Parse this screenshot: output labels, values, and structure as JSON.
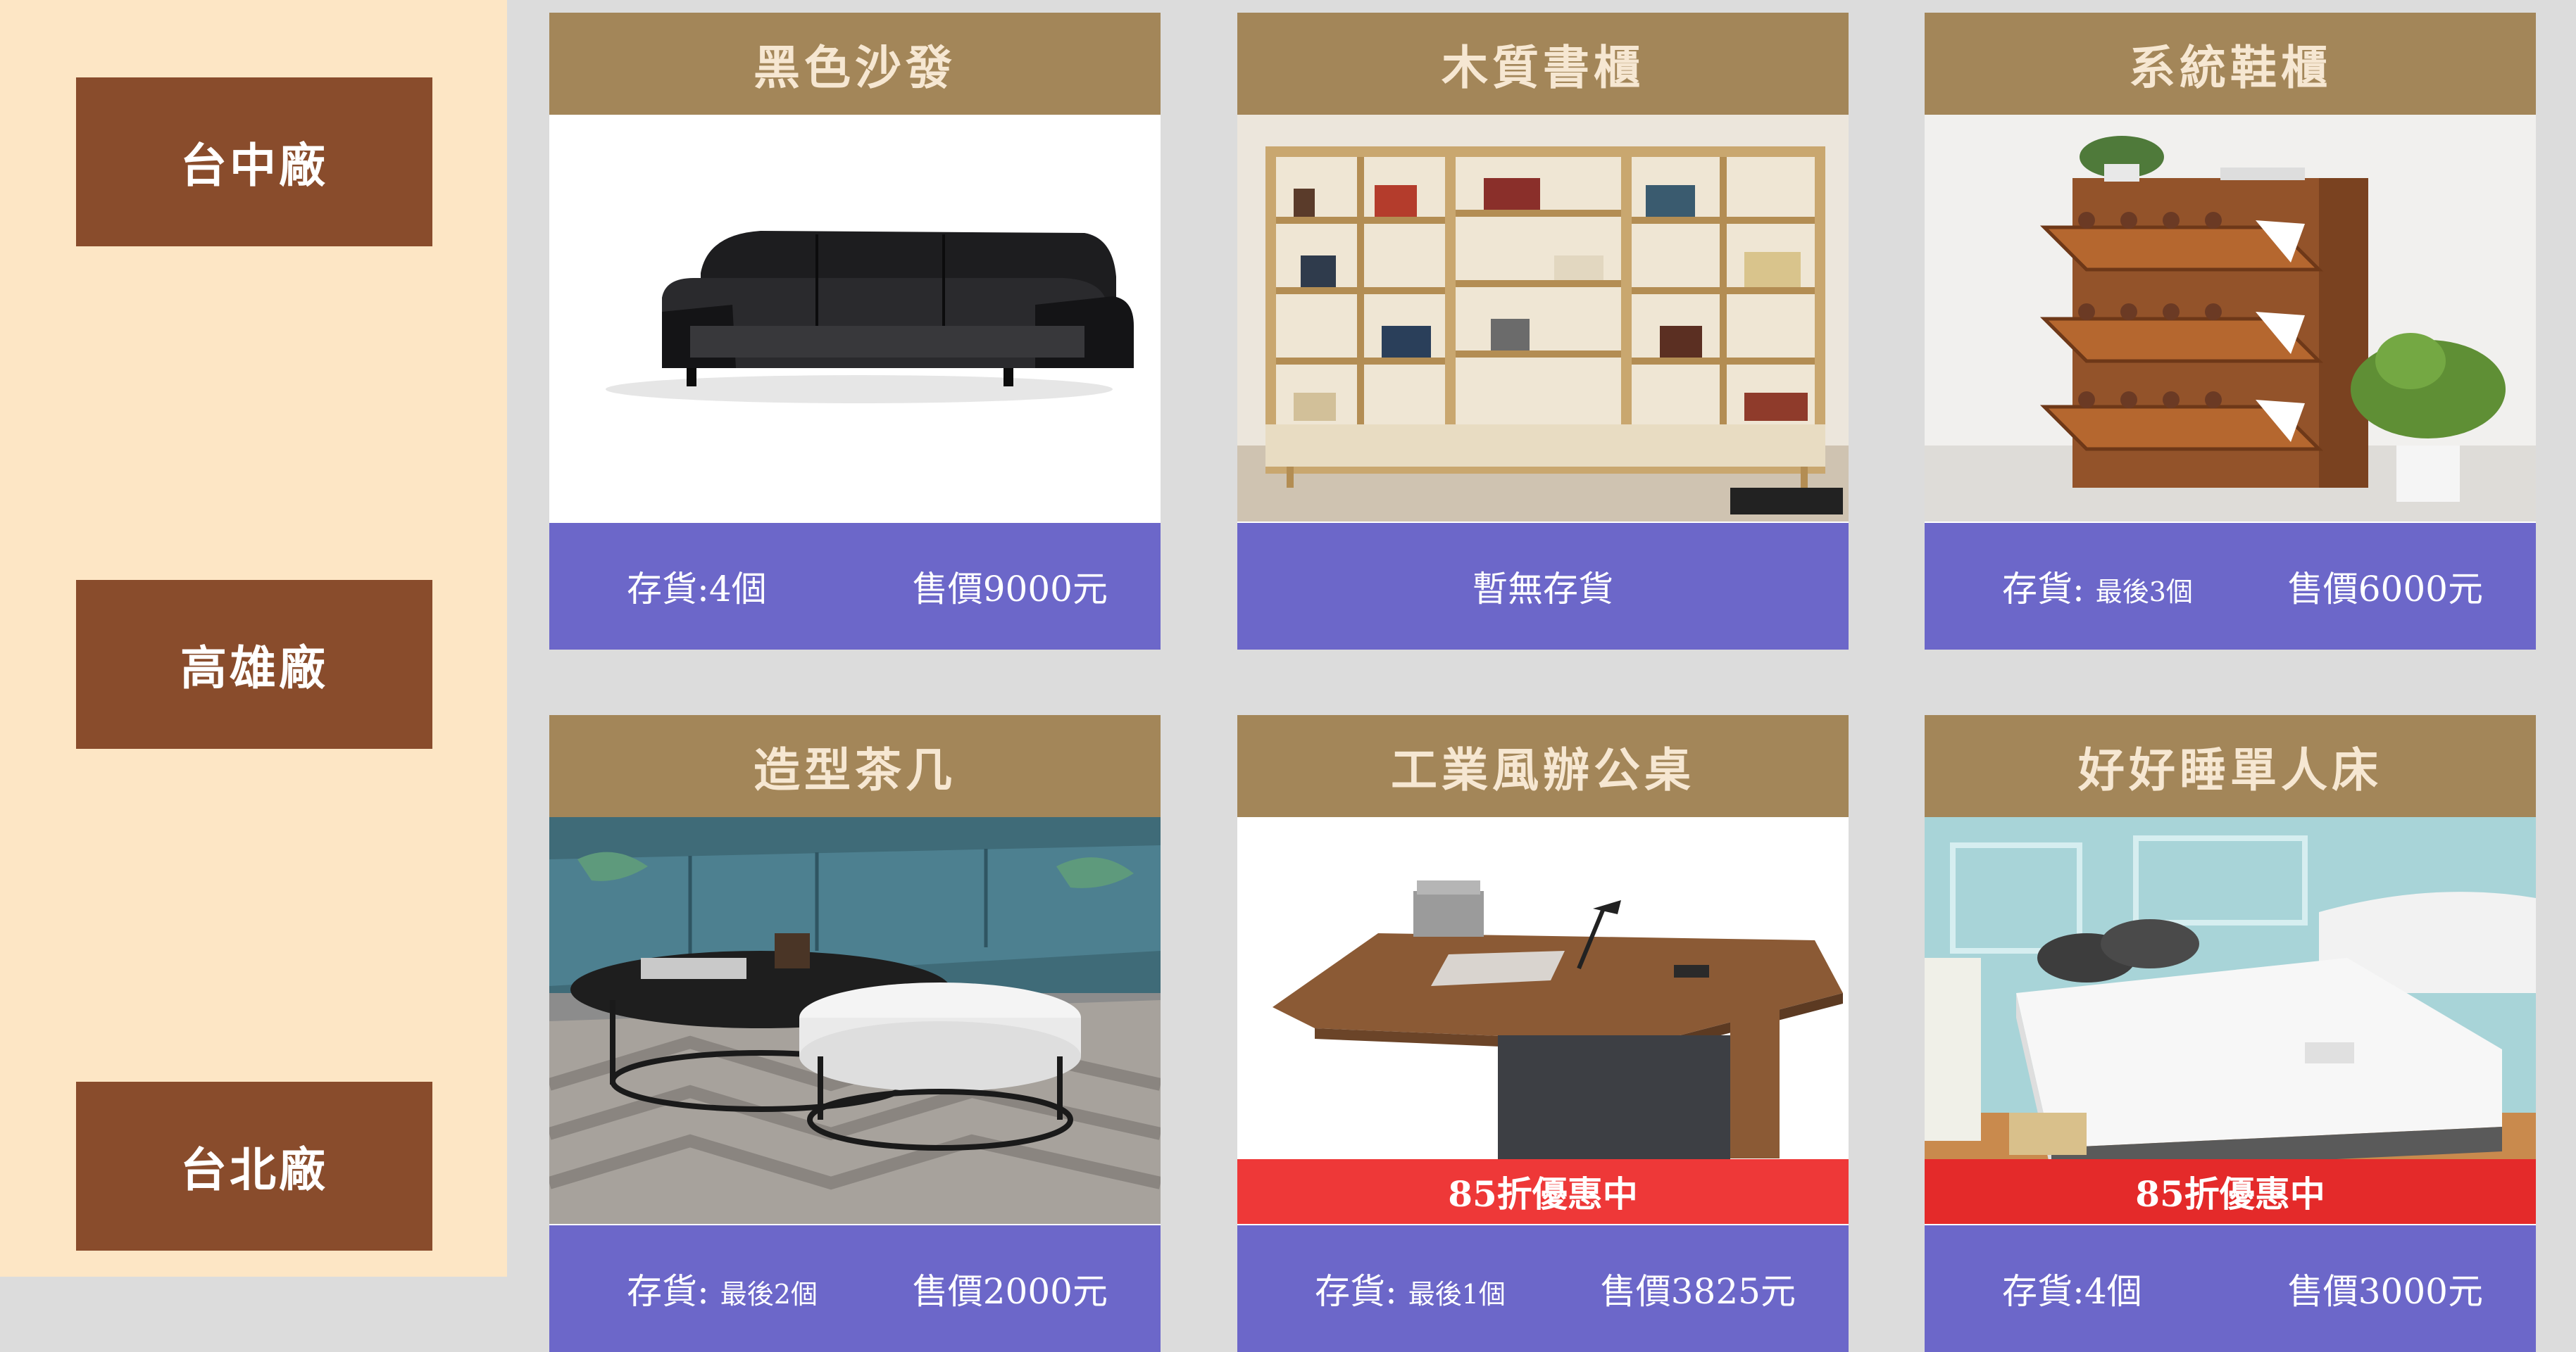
{
  "sidebar": {
    "factories": [
      "台中廠",
      "高雄廠",
      "台北廠"
    ]
  },
  "products": [
    {
      "name": "黑色沙發",
      "stock_label": "存貨:4個",
      "stock_note": "",
      "price": "售價9000元",
      "promo": ""
    },
    {
      "name": "木質書櫃",
      "stock_label": "暫無存貨",
      "stock_note": "",
      "price": "",
      "promo": ""
    },
    {
      "name": "系統鞋櫃",
      "stock_label": "存貨: ",
      "stock_note": "最後3個",
      "price": "售價6000元",
      "promo": ""
    },
    {
      "name": "造型茶几",
      "stock_label": "存貨: ",
      "stock_note": "最後2個",
      "price": "售價2000元",
      "promo": ""
    },
    {
      "name": "工業風辦公桌",
      "stock_label": "存貨: ",
      "stock_note": "最後1個",
      "price": "售價3825元",
      "promo": "85折優惠中"
    },
    {
      "name": "好好睡單人床",
      "stock_label": "存貨:4個",
      "stock_note": "",
      "price": "售價3000元",
      "promo": "85折優惠中"
    }
  ],
  "colors": {
    "sidebar_bg": "#fde6c5",
    "factory_button": "#894c2c",
    "card_title_bar": "#a38659",
    "card_footer": "#6c67c9",
    "promo_banner": "#ee3838"
  }
}
